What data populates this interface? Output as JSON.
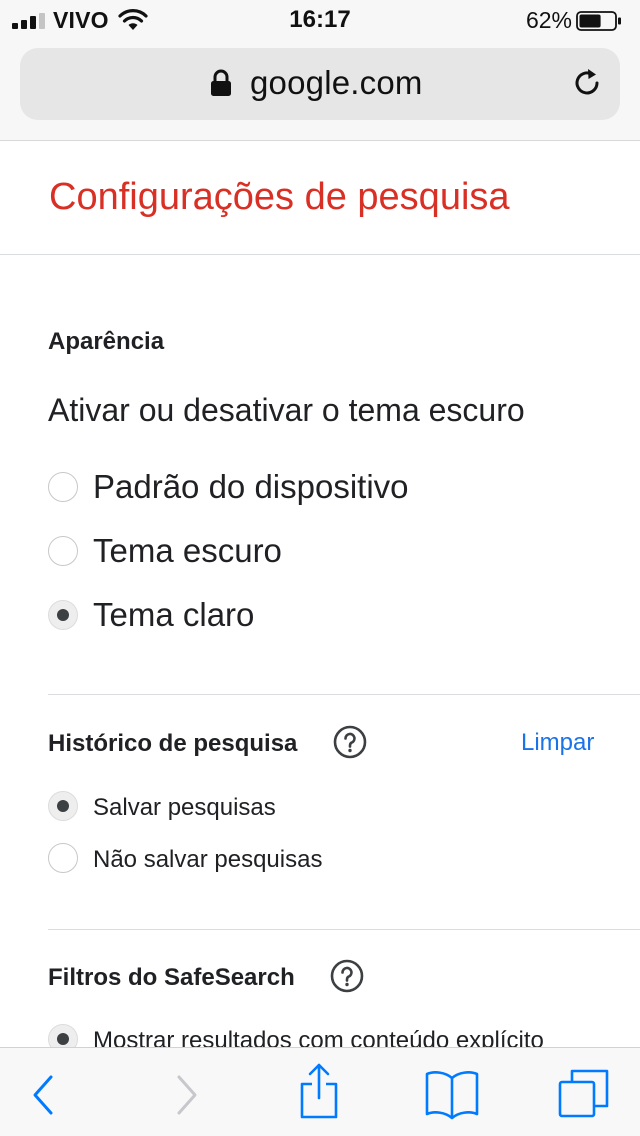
{
  "status_bar": {
    "carrier": "VIVO",
    "time": "16:17",
    "battery_percent": "62%",
    "battery_level": 0.62,
    "signal_bars_active": 3,
    "signal_bars_total": 4
  },
  "browser": {
    "url": "google.com",
    "secure_icon": "lock-icon",
    "reload_icon": "reload-icon"
  },
  "page": {
    "title": "Configurações de pesquisa",
    "title_color": "#d93025"
  },
  "appearance": {
    "heading": "Aparência",
    "question": "Ativar ou desativar o tema escuro",
    "options": [
      {
        "label": "Padrão do dispositivo",
        "selected": false
      },
      {
        "label": "Tema escuro",
        "selected": false
      },
      {
        "label": "Tema claro",
        "selected": true
      }
    ]
  },
  "history": {
    "heading": "Histórico de pesquisa",
    "clear_link": "Limpar",
    "link_color": "#1a73e8",
    "options": [
      {
        "label": "Salvar pesquisas",
        "selected": true
      },
      {
        "label": "Não salvar pesquisas",
        "selected": false
      }
    ]
  },
  "safesearch": {
    "heading": "Filtros do SafeSearch",
    "options": [
      {
        "label": "Mostrar resultados com conteúdo explícito",
        "selected": true
      }
    ]
  },
  "toolbar": {
    "back_icon": "back-icon",
    "forward_icon": "forward-icon",
    "share_icon": "share-icon",
    "bookmarks_icon": "bookmarks-icon",
    "tabs_icon": "tabs-icon",
    "accent_color": "#007aff"
  }
}
